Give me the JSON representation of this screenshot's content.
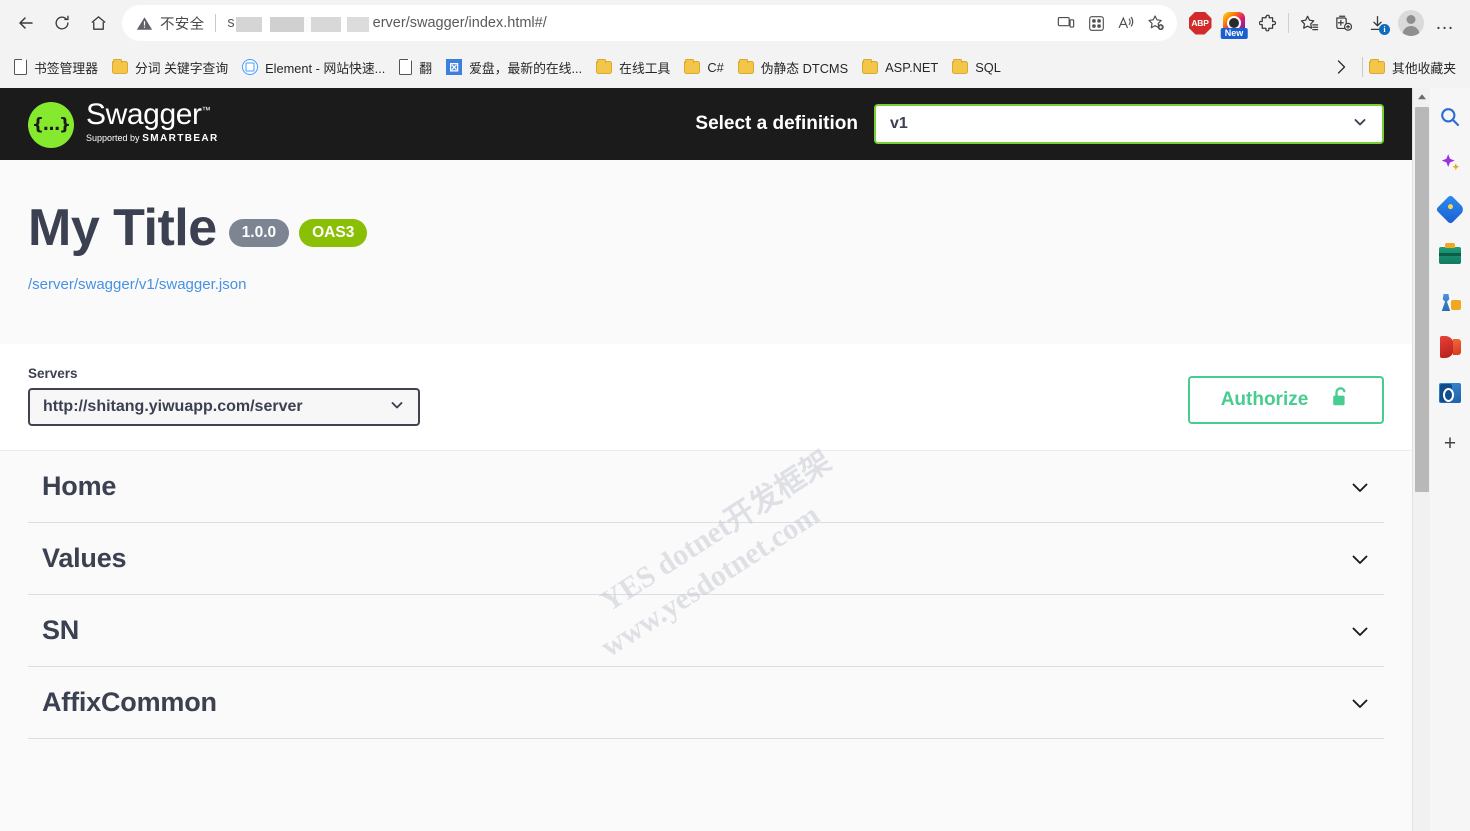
{
  "browser": {
    "nav": {
      "back": "back-arrow",
      "refresh": "refresh",
      "home": "home"
    },
    "omnibox": {
      "security_warning": "不安全",
      "url_prefix": "s",
      "url_suffix": "erver/swagger/index.html#/",
      "url_redacted": true,
      "icons": [
        "cast-device-icon",
        "split-screen-icon",
        "read-aloud-icon",
        "add-favorite-icon"
      ]
    },
    "toolbar_icons": [
      {
        "name": "adblock-plus-icon",
        "label": "ABP"
      },
      {
        "name": "extension-promo-icon",
        "badge": "New"
      },
      {
        "name": "extensions-puzzle-icon",
        "label": ""
      },
      {
        "name": "favorites-icon",
        "label": ""
      },
      {
        "name": "collections-icon",
        "label": ""
      },
      {
        "name": "downloads-icon",
        "badge": "i"
      },
      {
        "name": "profile-avatar",
        "label": ""
      },
      {
        "name": "settings-more-icon",
        "label": "…"
      }
    ],
    "bookmarks": [
      {
        "label": "书签管理器",
        "icon": "page-icon"
      },
      {
        "label": "分词 关键字查询",
        "icon": "folder-icon"
      },
      {
        "label": "Element - 网站快速...",
        "icon": "element-icon"
      },
      {
        "label": "翻",
        "icon": "page-icon"
      },
      {
        "label": "爱盘，最新的在线...",
        "icon": "x-icon"
      },
      {
        "label": "在线工具",
        "icon": "folder-icon"
      },
      {
        "label": "C#",
        "icon": "folder-icon"
      },
      {
        "label": "伪静态 DTCMS",
        "icon": "folder-icon"
      },
      {
        "label": "ASP.NET",
        "icon": "folder-icon"
      },
      {
        "label": "SQL",
        "icon": "folder-icon"
      }
    ],
    "bookmarks_overflow": "›",
    "other_bookmarks": {
      "label": "其他收藏夹",
      "icon": "folder-icon"
    }
  },
  "swagger": {
    "logo": {
      "glyph": "{…}",
      "title": "Swagger",
      "trademark": "™",
      "supported_prefix": "Supported by",
      "supported_brand": "SMARTBEAR"
    },
    "definition": {
      "label": "Select a definition",
      "selected": "v1",
      "options": [
        "v1"
      ]
    },
    "info": {
      "title": "My Title",
      "version_badge": "1.0.0",
      "spec_badge": "OAS3",
      "json_link": "/server/swagger/v1/swagger.json"
    },
    "servers": {
      "label": "Servers",
      "selected": "http://shitang.yiwuapp.com/server",
      "options": [
        "http://shitang.yiwuapp.com/server"
      ]
    },
    "authorize": {
      "label": "Authorize",
      "lock_state": "unlocked"
    },
    "tags": [
      {
        "name": "Home",
        "expanded": false
      },
      {
        "name": "Values",
        "expanded": false
      },
      {
        "name": "SN",
        "expanded": false
      },
      {
        "name": "AffixCommon",
        "expanded": false
      }
    ]
  },
  "watermark": {
    "line1": "YES  dotnet开发框架",
    "line2": "www.yesdotnet.com"
  },
  "edge_sidebar": {
    "icons": [
      {
        "name": "search-icon"
      },
      {
        "name": "copilot-sparkle-icon"
      },
      {
        "name": "shopping-tag-icon"
      },
      {
        "name": "tools-toolbox-icon"
      },
      {
        "name": "games-icon"
      },
      {
        "name": "office-icon"
      },
      {
        "name": "outlook-icon"
      }
    ],
    "add_button": "+"
  },
  "colors": {
    "swagger_green": "#85ea2d",
    "oas_badge": "#89bf04",
    "version_badge": "#7d8492",
    "authorize_green": "#49cc90",
    "topbar_dark": "#1b1b1b",
    "title_color": "#3b4151",
    "link_blue": "#4990e2"
  }
}
